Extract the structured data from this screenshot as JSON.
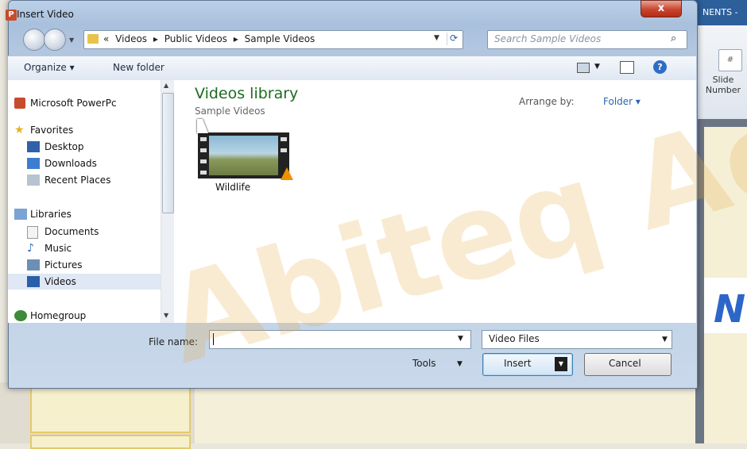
{
  "background_app": {
    "title_fragment": "NENTS -",
    "slide_number_label": "Slide\nNumber",
    "slide_number_icon": "#",
    "slide_letter": "N"
  },
  "dialog": {
    "title": "Insert Video",
    "app_icon": "P",
    "close_label": "x"
  },
  "address": {
    "crumbs": [
      "«",
      "Videos",
      "▸",
      "Public Videos",
      "▸",
      "Sample Videos"
    ],
    "refresh_icon": "refresh-icon"
  },
  "search": {
    "placeholder": "Search Sample Videos"
  },
  "toolbar": {
    "organize_label": "Organize ▾",
    "new_folder_label": "New folder",
    "help_label": "?"
  },
  "nav": {
    "top_item": "Microsoft PowerPc",
    "favorites": "Favorites",
    "favorites_items": [
      "Desktop",
      "Downloads",
      "Recent Places"
    ],
    "libraries": "Libraries",
    "libraries_items": [
      "Documents",
      "Music",
      "Pictures",
      "Videos"
    ],
    "homegroup": "Homegroup"
  },
  "content": {
    "library_title": "Videos library",
    "library_sub": "Sample Videos",
    "arrange_label": "Arrange by:",
    "arrange_value": "Folder ▾",
    "files": [
      {
        "name": "Wildlife",
        "type": "video"
      }
    ]
  },
  "bottom": {
    "file_name_label": "File name:",
    "file_name_value": "",
    "file_type_value": "Video Files",
    "tools_label": "Tools",
    "insert_label": "Insert",
    "cancel_label": "Cancel"
  },
  "watermark": "Abiteq Ac"
}
